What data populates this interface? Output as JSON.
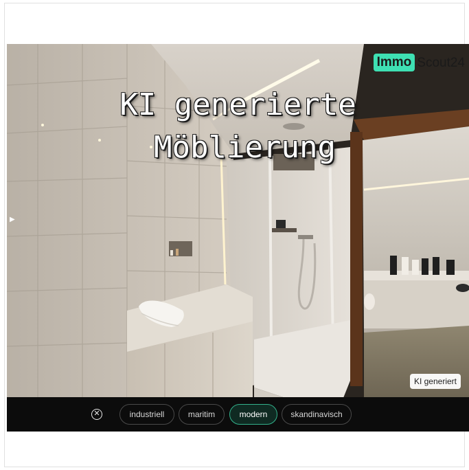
{
  "brand": {
    "part1": "Immo",
    "part2": "Scout24",
    "accent_color": "#3ee0b3"
  },
  "headline": {
    "line1": "KI generierte",
    "line2": "Möblierung"
  },
  "badge": {
    "label": "KI generiert"
  },
  "toolbar": {
    "close_icon": "close-circle-icon",
    "chips": [
      {
        "label": "industriell",
        "active": false
      },
      {
        "label": "maritim",
        "active": false
      },
      {
        "label": "modern",
        "active": true
      },
      {
        "label": "skandinavisch",
        "active": false
      }
    ]
  },
  "icons": {
    "side_arrow": "play-arrow-icon"
  }
}
